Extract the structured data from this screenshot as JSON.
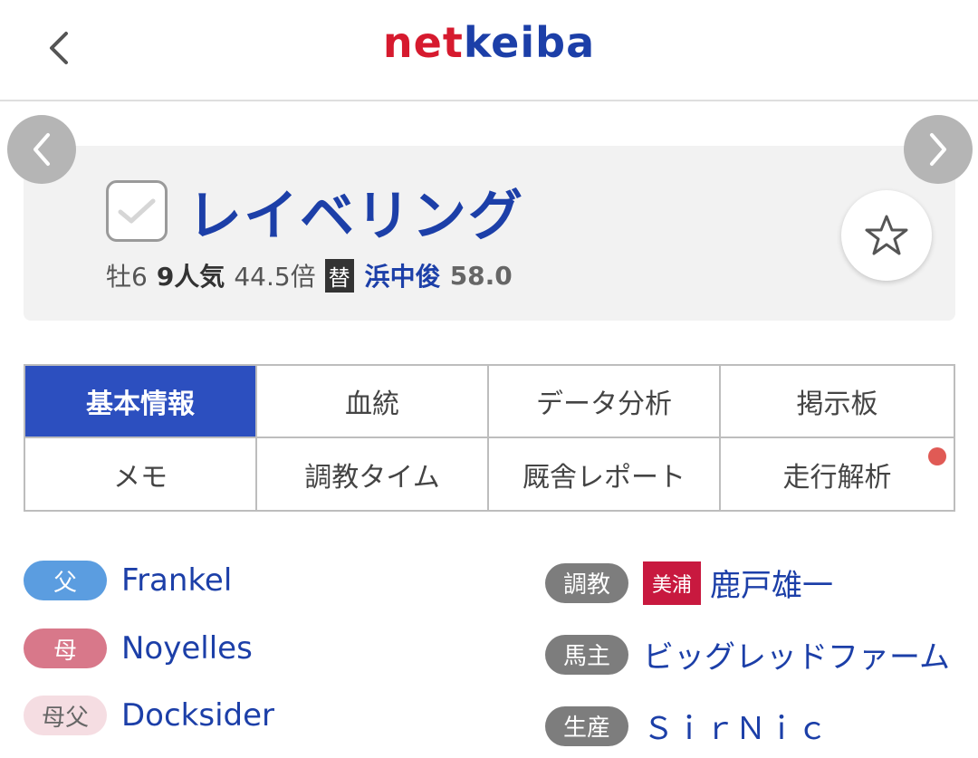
{
  "header": {
    "logo_net": "net",
    "logo_keiba": "keiba"
  },
  "horse": {
    "name": "レイベリング",
    "sex_age": "牡6",
    "popularity": "9人気",
    "odds": "44.5倍",
    "change_badge": "替",
    "jockey": "浜中俊",
    "weight": "58.0"
  },
  "tabs": [
    {
      "label": "基本情報",
      "active": true
    },
    {
      "label": "血統"
    },
    {
      "label": "データ分析"
    },
    {
      "label": "掲示板"
    },
    {
      "label": "メモ"
    },
    {
      "label": "調教タイム"
    },
    {
      "label": "厩舎レポート"
    },
    {
      "label": "走行解析",
      "has_new_dot": true
    }
  ],
  "pedigree": {
    "sire_label": "父",
    "sire": "Frankel",
    "dam_label": "母",
    "dam": "Noyelles",
    "damsire_label": "母父",
    "damsire": "Docksider"
  },
  "staff": {
    "trainer_label": "調教",
    "trainer_region": "美浦",
    "trainer": "鹿戸雄一",
    "owner_label": "馬主",
    "owner": "ビッグレッドファーム",
    "breeder_label": "生産",
    "breeder": "ＳｉｒＮｉｃ"
  },
  "colors": {
    "brand_red": "#d61a2e",
    "brand_blue": "#1c3fa8",
    "active_tab": "#2c4fbf",
    "sire_pill": "#5b9de0",
    "dam_pill": "#d8788a",
    "damsire_pill": "#f5dde2",
    "region_badge": "#c8193f",
    "new_dot": "#e05a55"
  },
  "icons": {
    "back": "chevron-left-icon",
    "prev": "chevron-left-icon",
    "next": "chevron-right-icon",
    "check": "check-icon",
    "favorite": "star-icon"
  }
}
